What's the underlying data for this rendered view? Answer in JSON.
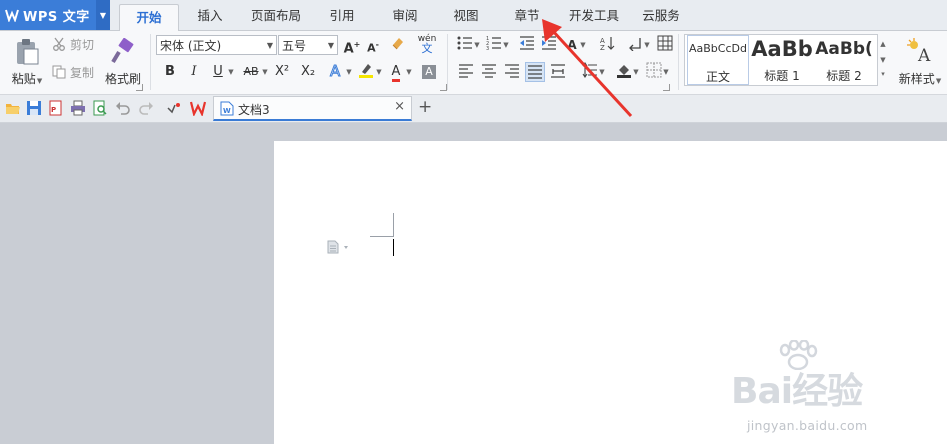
{
  "app": {
    "title": "WPS 文字"
  },
  "menu": {
    "tabs": [
      {
        "label": "开始",
        "active": true
      },
      {
        "label": "插入"
      },
      {
        "label": "页面布局"
      },
      {
        "label": "引用"
      },
      {
        "label": "审阅"
      },
      {
        "label": "视图"
      },
      {
        "label": "章节"
      },
      {
        "label": "开发工具"
      },
      {
        "label": "云服务"
      }
    ]
  },
  "ribbon": {
    "paste_label": "粘贴",
    "cut_label": "剪切",
    "copy_label": "复制",
    "format_painter_label": "格式刷",
    "font_name": "宋体 (正文)",
    "font_size": "五号",
    "bold": "B",
    "italic": "I",
    "underline": "U",
    "strikethrough": "AB",
    "superscript": "X²",
    "subscript": "X₂",
    "font_color_letter": "A",
    "pinyin_label": "wén",
    "styles": [
      {
        "sample": "AaBbCcDd",
        "name": "正文"
      },
      {
        "sample": "AaBb",
        "name": "标题 1"
      },
      {
        "sample": "AaBb(",
        "name": "标题 2"
      }
    ],
    "new_style_label": "新样式"
  },
  "doc_tab": {
    "label": "文档3"
  },
  "watermark": {
    "text": "Bai经验",
    "url": "jingyan.baidu.com"
  },
  "colors": {
    "accent": "#3b7dd8",
    "annotation": "#e8342c"
  }
}
